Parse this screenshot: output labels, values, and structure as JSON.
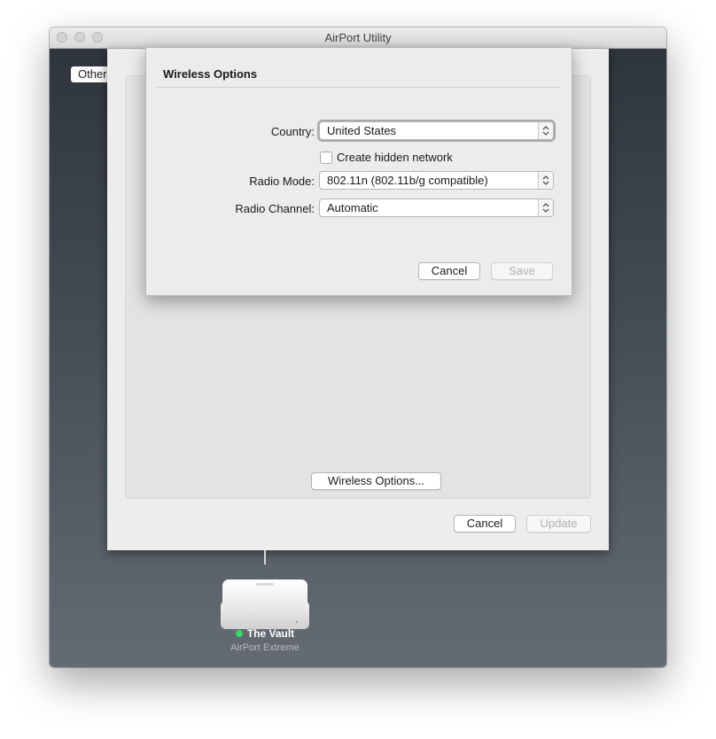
{
  "window": {
    "title": "AirPort Utility"
  },
  "toolbar": {
    "other_label": "Other"
  },
  "sheet": {
    "wireless_options_label": "Wireless Options...",
    "cancel_label": "Cancel",
    "update_label": "Update"
  },
  "device": {
    "name": "The Vault",
    "type": "AirPort Extreme",
    "status_color": "#3fd36c"
  },
  "dialog": {
    "title": "Wireless Options",
    "country": {
      "label": "Country:",
      "value": "United States"
    },
    "hidden_network": {
      "label": "Create hidden network",
      "checked": false
    },
    "radio_mode": {
      "label": "Radio Mode:",
      "value": "802.11n (802.11b/g compatible)"
    },
    "radio_channel": {
      "label": "Radio Channel:",
      "value": "Automatic"
    },
    "cancel_label": "Cancel",
    "save_label": "Save"
  },
  "icons": {
    "window_controls": [
      "close-icon",
      "minimize-icon",
      "zoom-icon"
    ],
    "popup_arrows": "chevron-updown-icon",
    "device": "airport-extreme-icon"
  }
}
